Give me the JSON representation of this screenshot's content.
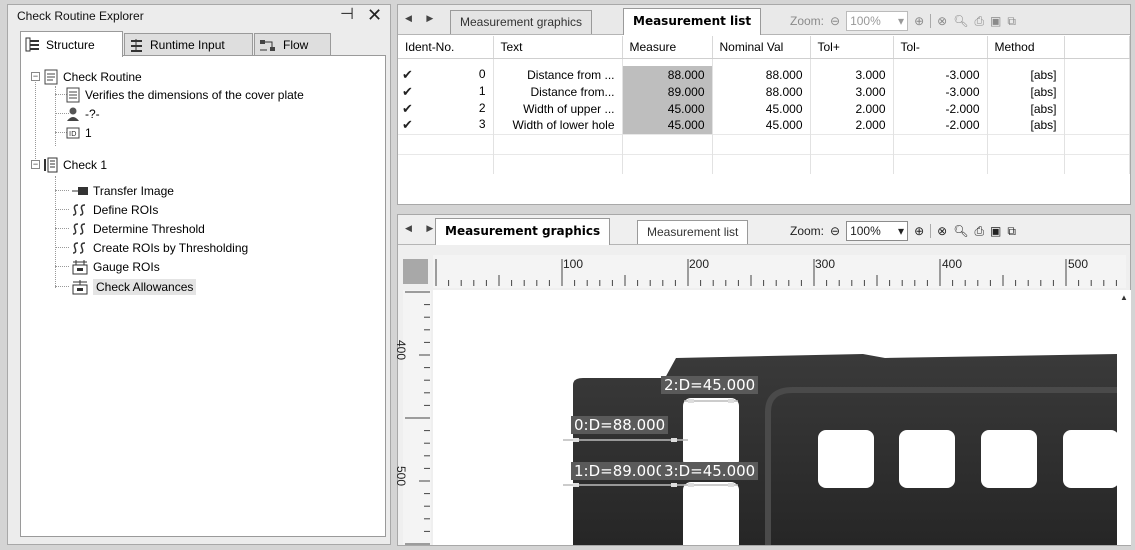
{
  "explorer": {
    "title": "Check Routine Explorer",
    "tabs": [
      "Structure",
      "Runtime Input",
      "Flow"
    ],
    "tree": {
      "routine": "Check Routine",
      "description": "Verifies the dimensions of the cover plate",
      "user": "-?-",
      "id_value": "1",
      "check": "Check 1",
      "steps": [
        "Transfer Image",
        "Define ROIs",
        "Determine Threshold",
        "Create ROIs by Thresholding",
        "Gauge ROIs",
        "Check Allowances"
      ]
    }
  },
  "top_pane": {
    "tabs": [
      "Measurement graphics",
      "Measurement list"
    ],
    "active_tab": "Measurement list",
    "zoom_label": "Zoom:",
    "zoom_value": "100%",
    "columns": [
      "Ident-No.",
      "Text",
      "Measure",
      "Nominal Val",
      "Tol+",
      "Tol-",
      "Method"
    ],
    "rows": [
      {
        "id": "0",
        "text": "Distance from ...",
        "measure": "88.000",
        "nominal": "88.000",
        "tol_plus": "3.000",
        "tol_minus": "-3.000",
        "method": "[abs]"
      },
      {
        "id": "1",
        "text": "Distance from...",
        "measure": "89.000",
        "nominal": "88.000",
        "tol_plus": "3.000",
        "tol_minus": "-3.000",
        "method": "[abs]"
      },
      {
        "id": "2",
        "text": "Width of upper ...",
        "measure": "45.000",
        "nominal": "45.000",
        "tol_plus": "2.000",
        "tol_minus": "-2.000",
        "method": "[abs]"
      },
      {
        "id": "3",
        "text": "Width of lower hole",
        "measure": "45.000",
        "nominal": "45.000",
        "tol_plus": "2.000",
        "tol_minus": "-2.000",
        "method": "[abs]"
      }
    ]
  },
  "bottom_pane": {
    "tabs": [
      "Measurement graphics",
      "Measurement list"
    ],
    "active_tab": "Measurement graphics",
    "zoom_label": "Zoom:",
    "zoom_value": "100%",
    "hruler_labels": [
      "100",
      "200",
      "300",
      "400",
      "500"
    ],
    "vruler_labels": [
      "400",
      "500"
    ],
    "annotations": [
      "0:D=88.000",
      "1:D=89.000",
      "2:D=45.000",
      "3:D=45.000"
    ]
  },
  "colors": {
    "measure_cell": "#bebebe",
    "annotation_bg": "#5a5a5a",
    "image_dark": "#2f2f2f"
  }
}
